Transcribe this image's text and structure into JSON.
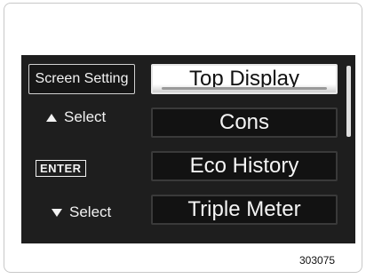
{
  "left_panel": {
    "screen_setting": "Screen Setting",
    "select_up": "Select",
    "enter": "ENTER",
    "select_down": "Select"
  },
  "menu": {
    "items": [
      {
        "label": "Top Display",
        "selected": true
      },
      {
        "label": "Cons",
        "selected": false
      },
      {
        "label": "Eco History",
        "selected": false
      },
      {
        "label": "Triple Meter",
        "selected": false
      }
    ]
  },
  "figure_number": "303075",
  "colors": {
    "screen_bg": "#1e1e1e",
    "selected_bg": "#ffffff",
    "text": "#f5f5f5"
  },
  "icons": {
    "up": "triangle-up-icon",
    "down": "triangle-down-icon"
  }
}
